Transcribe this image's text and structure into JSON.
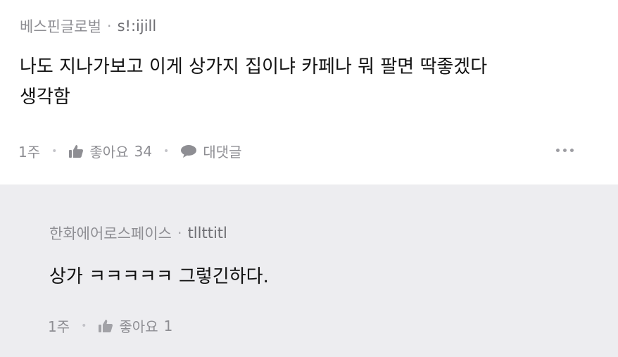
{
  "comment": {
    "author": "베스핀글로벌",
    "separator": "·",
    "handle": "s!:ijill",
    "text_line1": "나도 지나가보고 이게 상가지 집이냐 카페나 뭐 팔면 딱좋겠다",
    "text_line2": "생각함",
    "time": "1주",
    "like_label": "좋아요",
    "like_count": "34",
    "reply_label": "대댓글",
    "icons": [
      "thumbs-up-icon",
      "speech-bubble-icon",
      "more-icon"
    ]
  },
  "reply": {
    "author": "한화에어로스페이스",
    "separator": "·",
    "handle": "tllttitl",
    "text": "상가 ㅋㅋㅋㅋㅋ 그렇긴하다.",
    "time": "1주",
    "like_label": "좋아요",
    "like_count": "1",
    "icons": [
      "thumbs-up-icon"
    ]
  },
  "colors": {
    "reply_background": "#ededf0",
    "meta_gray": "#8e8e93",
    "body_text": "#111111"
  }
}
